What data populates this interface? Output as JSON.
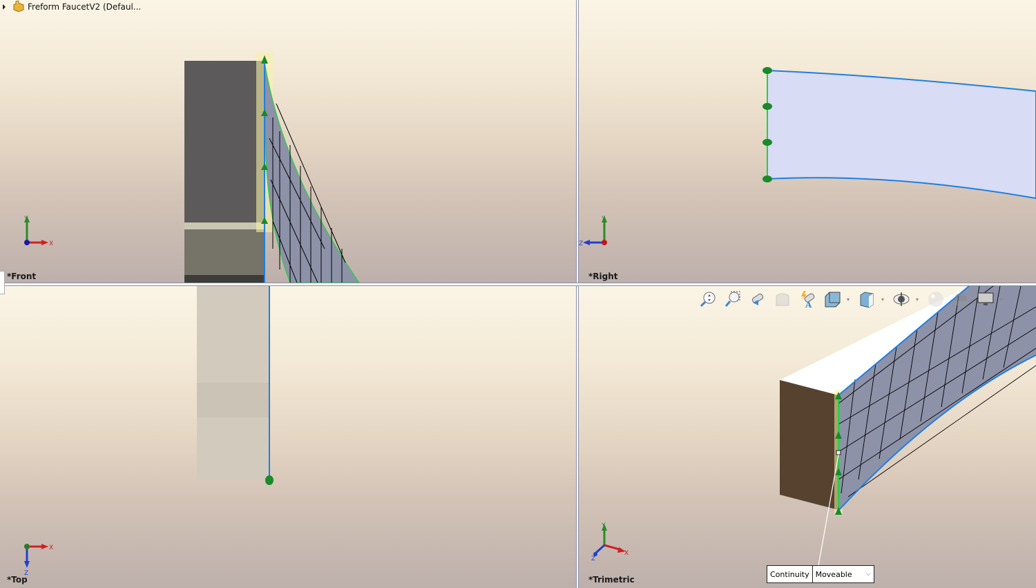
{
  "document": {
    "title": "Freform FaucetV2  (Defaul...",
    "tree_expand_icon": "triangle-right-icon",
    "part_icon": "part-icon"
  },
  "viewports": [
    {
      "id": "front",
      "label": "*Front",
      "triad": {
        "axes": [
          "Y",
          "X"
        ]
      }
    },
    {
      "id": "right",
      "label": "*Right",
      "triad": {
        "axes": [
          "Y",
          "Z"
        ]
      }
    },
    {
      "id": "top",
      "label": "*Top",
      "triad": {
        "axes": [
          "X",
          "Z"
        ]
      }
    },
    {
      "id": "trimetric",
      "label": "*Trimetric",
      "triad": {
        "axes": [
          "Y",
          "X",
          "Z"
        ]
      }
    }
  ],
  "heads_up_toolbar": [
    {
      "name": "zoom-to-fit",
      "icon": "zoom-to-fit-icon"
    },
    {
      "name": "zoom-to-area",
      "icon": "zoom-to-area-icon"
    },
    {
      "name": "previous-view",
      "icon": "previous-view-icon"
    },
    {
      "name": "section-view",
      "icon": "section-view-icon"
    },
    {
      "name": "dynamic-annotation-views",
      "icon": "dynamic-annotation-icon"
    },
    {
      "name": "view-orientation",
      "icon": "view-orientation-icon",
      "dropdown": true
    },
    {
      "name": "display-style",
      "icon": "display-style-icon",
      "dropdown": true
    },
    {
      "name": "hide-show-items",
      "icon": "eye-icon",
      "dropdown": true
    },
    {
      "name": "edit-appearance",
      "icon": "appearance-icon"
    },
    {
      "name": "apply-scene",
      "icon": "scene-icon",
      "dropdown": true
    },
    {
      "name": "view-settings",
      "icon": "monitor-icon",
      "dropdown": true
    }
  ],
  "callout": {
    "label": "Continuity",
    "value": "Moveable",
    "chevron": "chevron-down-icon"
  },
  "colors": {
    "edge_blue": "#1e7fe0",
    "handle_green": "#1a8a2a",
    "surface_face": "#8d92a8",
    "body_dark": "#5c5a5a",
    "body_brown": "#574230",
    "surface_light": "#d8dcf4"
  }
}
